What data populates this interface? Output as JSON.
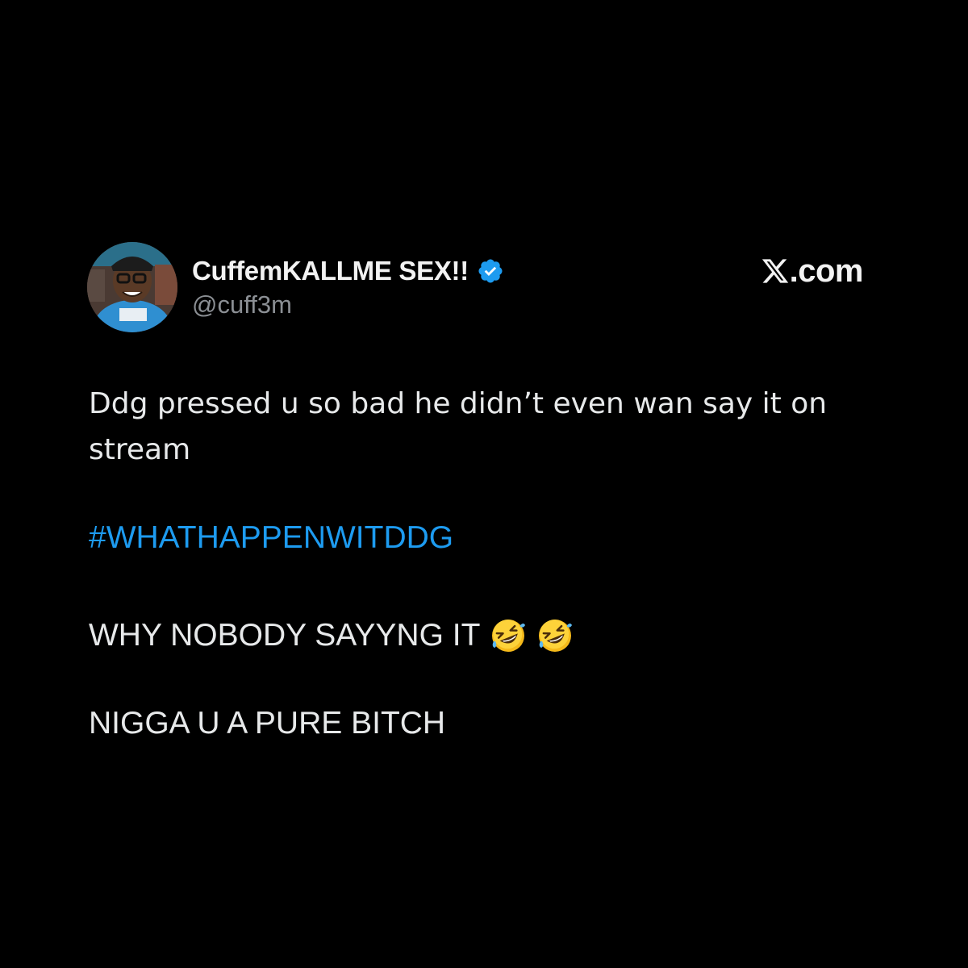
{
  "post": {
    "author": {
      "display_name": "CuffemKALLME SEX!!",
      "handle": "@cuff3m",
      "verified": true,
      "avatar": "avatar-photo"
    },
    "brand": {
      "logo_icon": "x-logo-icon",
      "text": ".com"
    },
    "text": {
      "line1": "Ddg pressed u so bad he didn’t even wan say it on stream",
      "hashtag": "#WHATHAPPENWITDDG",
      "line3": "WHY NOBODY SAYYNG IT",
      "line3_emoji": [
        "rolling-on-floor-laughing-emoji",
        "rolling-on-floor-laughing-emoji"
      ],
      "line4": "NIGGA U A PURE BITCH"
    }
  },
  "colors": {
    "background": "#000000",
    "text": "#e7e9ea",
    "secondary": "#8b8f94",
    "accent": "#1d9bf0"
  }
}
